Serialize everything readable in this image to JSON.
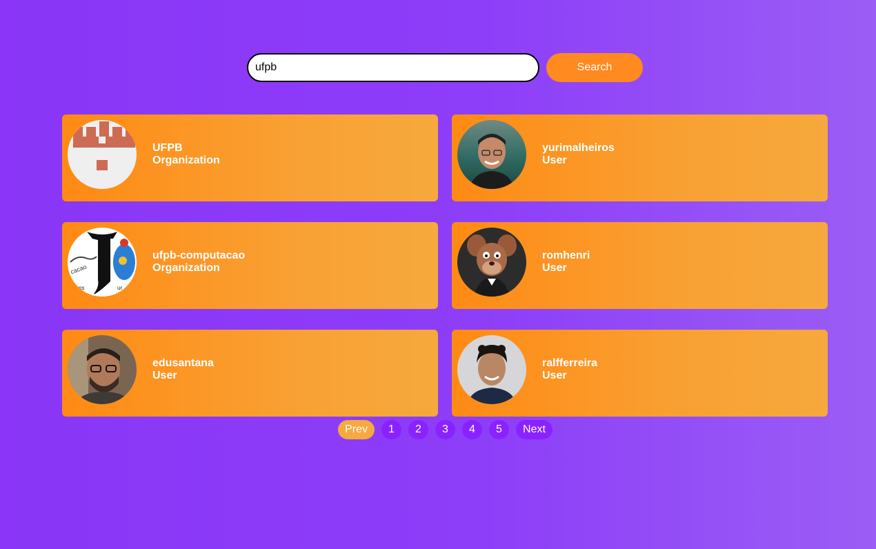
{
  "search": {
    "value": "ufpb",
    "button_label": "Search"
  },
  "results": [
    {
      "name": "UFPB",
      "type": "Organization"
    },
    {
      "name": "yurimalheiros",
      "type": "User"
    },
    {
      "name": "ufpb-computacao",
      "type": "Organization"
    },
    {
      "name": "romhenri",
      "type": "User"
    },
    {
      "name": "edusantana",
      "type": "User"
    },
    {
      "name": "ralfferreira",
      "type": "User"
    }
  ],
  "pagination": {
    "prev_label": "Prev",
    "pages": [
      "1",
      "2",
      "3",
      "4",
      "5"
    ],
    "next_label": "Next"
  },
  "colors": {
    "background": "#8a35f7",
    "accent": "#ff8a1f",
    "page_button": "#8a22ff",
    "prev_button": "#f5a93e"
  }
}
